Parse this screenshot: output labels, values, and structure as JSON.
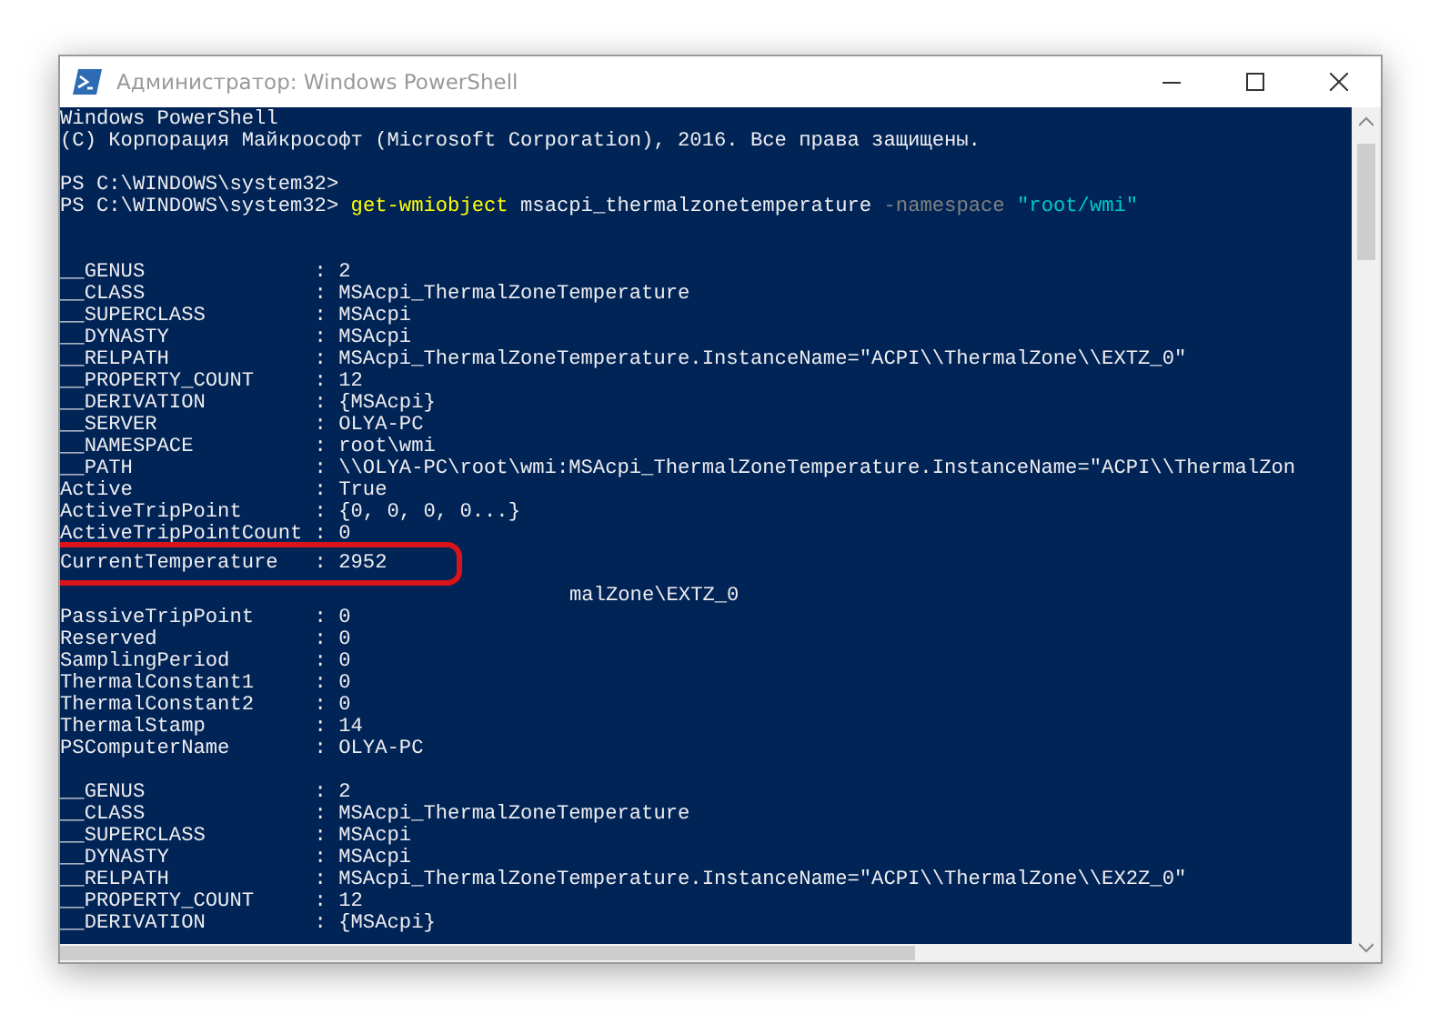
{
  "window": {
    "title": "Администратор: Windows PowerShell"
  },
  "console": {
    "lines": [
      {
        "kind": "text",
        "text": "Windows PowerShell"
      },
      {
        "kind": "text",
        "text": "(C) Корпорация Майкрософт (Microsoft Corporation), 2016. Все права защищены."
      },
      {
        "kind": "blank"
      },
      {
        "kind": "text",
        "text": "PS C:\\WINDOWS\\system32>"
      },
      {
        "kind": "prompt",
        "tokens": [
          {
            "kind": "plain",
            "text": "PS C:\\WINDOWS\\system32>"
          },
          {
            "kind": "command",
            "text": "get-wmiobject"
          },
          {
            "kind": "plain",
            "text": "msacpi_thermalzonetemperature"
          },
          {
            "kind": "parameter",
            "text": "-namespace"
          },
          {
            "kind": "string",
            "text": "\"root/wmi\""
          }
        ]
      },
      {
        "kind": "blank"
      },
      {
        "kind": "blank"
      },
      {
        "kind": "text",
        "text": "__GENUS              : 2"
      },
      {
        "kind": "text",
        "text": "__CLASS              : MSAcpi_ThermalZoneTemperature"
      },
      {
        "kind": "text",
        "text": "__SUPERCLASS         : MSAcpi"
      },
      {
        "kind": "text",
        "text": "__DYNASTY            : MSAcpi"
      },
      {
        "kind": "text",
        "text": "__RELPATH            : MSAcpi_ThermalZoneTemperature.InstanceName=\"ACPI\\\\ThermalZone\\\\EXTZ_0\""
      },
      {
        "kind": "text",
        "text": "__PROPERTY_COUNT     : 12"
      },
      {
        "kind": "text",
        "text": "__DERIVATION         : {MSAcpi}"
      },
      {
        "kind": "text",
        "text": "__SERVER             : OLYA-PC"
      },
      {
        "kind": "text",
        "text": "__NAMESPACE          : root\\wmi"
      },
      {
        "kind": "text",
        "text": "__PATH               : \\\\OLYA-PC\\root\\wmi:MSAcpi_ThermalZoneTemperature.InstanceName=\"ACPI\\\\ThermalZon"
      },
      {
        "kind": "text",
        "text": "Active               : True"
      },
      {
        "kind": "text",
        "text": "ActiveTripPoint      : {0, 0, 0, 0...}"
      },
      {
        "kind": "text",
        "text": "ActiveTripPointCount : 0"
      },
      {
        "kind": "highlight",
        "text": "CurrentTemperature   : 2952"
      },
      {
        "kind": "fragment",
        "text": "malZone\\EXTZ_0"
      },
      {
        "kind": "text",
        "text": "PassiveTripPoint     : 0"
      },
      {
        "kind": "text",
        "text": "Reserved             : 0"
      },
      {
        "kind": "text",
        "text": "SamplingPeriod       : 0"
      },
      {
        "kind": "text",
        "text": "ThermalConstant1     : 0"
      },
      {
        "kind": "text",
        "text": "ThermalConstant2     : 0"
      },
      {
        "kind": "text",
        "text": "ThermalStamp         : 14"
      },
      {
        "kind": "text",
        "text": "PSComputerName       : OLYA-PC"
      },
      {
        "kind": "blank"
      },
      {
        "kind": "text",
        "text": "__GENUS              : 2"
      },
      {
        "kind": "text",
        "text": "__CLASS              : MSAcpi_ThermalZoneTemperature"
      },
      {
        "kind": "text",
        "text": "__SUPERCLASS         : MSAcpi"
      },
      {
        "kind": "text",
        "text": "__DYNASTY            : MSAcpi"
      },
      {
        "kind": "text",
        "text": "__RELPATH            : MSAcpi_ThermalZoneTemperature.InstanceName=\"ACPI\\\\ThermalZone\\\\EX2Z_0\""
      },
      {
        "kind": "text",
        "text": "__PROPERTY_COUNT     : 12"
      },
      {
        "kind": "text",
        "text": "__DERIVATION         : {MSAcpi}"
      }
    ]
  }
}
